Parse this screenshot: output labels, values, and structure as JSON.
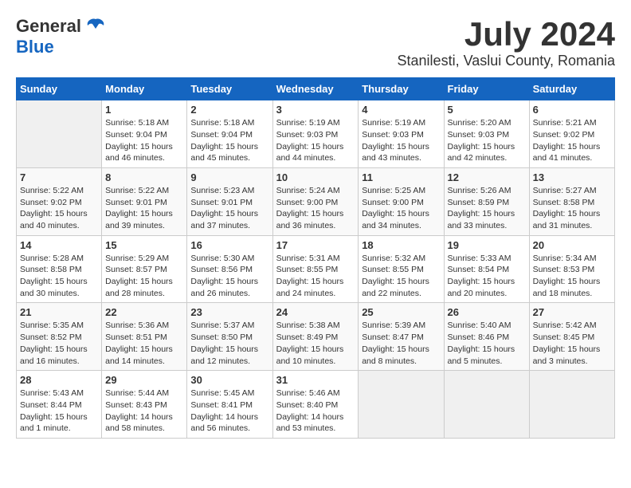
{
  "logo": {
    "general": "General",
    "blue": "Blue"
  },
  "title": {
    "month_year": "July 2024",
    "location": "Stanilesti, Vaslui County, Romania"
  },
  "headers": [
    "Sunday",
    "Monday",
    "Tuesday",
    "Wednesday",
    "Thursday",
    "Friday",
    "Saturday"
  ],
  "weeks": [
    [
      {
        "day": "",
        "info": ""
      },
      {
        "day": "1",
        "info": "Sunrise: 5:18 AM\nSunset: 9:04 PM\nDaylight: 15 hours\nand 46 minutes."
      },
      {
        "day": "2",
        "info": "Sunrise: 5:18 AM\nSunset: 9:04 PM\nDaylight: 15 hours\nand 45 minutes."
      },
      {
        "day": "3",
        "info": "Sunrise: 5:19 AM\nSunset: 9:03 PM\nDaylight: 15 hours\nand 44 minutes."
      },
      {
        "day": "4",
        "info": "Sunrise: 5:19 AM\nSunset: 9:03 PM\nDaylight: 15 hours\nand 43 minutes."
      },
      {
        "day": "5",
        "info": "Sunrise: 5:20 AM\nSunset: 9:03 PM\nDaylight: 15 hours\nand 42 minutes."
      },
      {
        "day": "6",
        "info": "Sunrise: 5:21 AM\nSunset: 9:02 PM\nDaylight: 15 hours\nand 41 minutes."
      }
    ],
    [
      {
        "day": "7",
        "info": "Sunrise: 5:22 AM\nSunset: 9:02 PM\nDaylight: 15 hours\nand 40 minutes."
      },
      {
        "day": "8",
        "info": "Sunrise: 5:22 AM\nSunset: 9:01 PM\nDaylight: 15 hours\nand 39 minutes."
      },
      {
        "day": "9",
        "info": "Sunrise: 5:23 AM\nSunset: 9:01 PM\nDaylight: 15 hours\nand 37 minutes."
      },
      {
        "day": "10",
        "info": "Sunrise: 5:24 AM\nSunset: 9:00 PM\nDaylight: 15 hours\nand 36 minutes."
      },
      {
        "day": "11",
        "info": "Sunrise: 5:25 AM\nSunset: 9:00 PM\nDaylight: 15 hours\nand 34 minutes."
      },
      {
        "day": "12",
        "info": "Sunrise: 5:26 AM\nSunset: 8:59 PM\nDaylight: 15 hours\nand 33 minutes."
      },
      {
        "day": "13",
        "info": "Sunrise: 5:27 AM\nSunset: 8:58 PM\nDaylight: 15 hours\nand 31 minutes."
      }
    ],
    [
      {
        "day": "14",
        "info": "Sunrise: 5:28 AM\nSunset: 8:58 PM\nDaylight: 15 hours\nand 30 minutes."
      },
      {
        "day": "15",
        "info": "Sunrise: 5:29 AM\nSunset: 8:57 PM\nDaylight: 15 hours\nand 28 minutes."
      },
      {
        "day": "16",
        "info": "Sunrise: 5:30 AM\nSunset: 8:56 PM\nDaylight: 15 hours\nand 26 minutes."
      },
      {
        "day": "17",
        "info": "Sunrise: 5:31 AM\nSunset: 8:55 PM\nDaylight: 15 hours\nand 24 minutes."
      },
      {
        "day": "18",
        "info": "Sunrise: 5:32 AM\nSunset: 8:55 PM\nDaylight: 15 hours\nand 22 minutes."
      },
      {
        "day": "19",
        "info": "Sunrise: 5:33 AM\nSunset: 8:54 PM\nDaylight: 15 hours\nand 20 minutes."
      },
      {
        "day": "20",
        "info": "Sunrise: 5:34 AM\nSunset: 8:53 PM\nDaylight: 15 hours\nand 18 minutes."
      }
    ],
    [
      {
        "day": "21",
        "info": "Sunrise: 5:35 AM\nSunset: 8:52 PM\nDaylight: 15 hours\nand 16 minutes."
      },
      {
        "day": "22",
        "info": "Sunrise: 5:36 AM\nSunset: 8:51 PM\nDaylight: 15 hours\nand 14 minutes."
      },
      {
        "day": "23",
        "info": "Sunrise: 5:37 AM\nSunset: 8:50 PM\nDaylight: 15 hours\nand 12 minutes."
      },
      {
        "day": "24",
        "info": "Sunrise: 5:38 AM\nSunset: 8:49 PM\nDaylight: 15 hours\nand 10 minutes."
      },
      {
        "day": "25",
        "info": "Sunrise: 5:39 AM\nSunset: 8:47 PM\nDaylight: 15 hours\nand 8 minutes."
      },
      {
        "day": "26",
        "info": "Sunrise: 5:40 AM\nSunset: 8:46 PM\nDaylight: 15 hours\nand 5 minutes."
      },
      {
        "day": "27",
        "info": "Sunrise: 5:42 AM\nSunset: 8:45 PM\nDaylight: 15 hours\nand 3 minutes."
      }
    ],
    [
      {
        "day": "28",
        "info": "Sunrise: 5:43 AM\nSunset: 8:44 PM\nDaylight: 15 hours\nand 1 minute."
      },
      {
        "day": "29",
        "info": "Sunrise: 5:44 AM\nSunset: 8:43 PM\nDaylight: 14 hours\nand 58 minutes."
      },
      {
        "day": "30",
        "info": "Sunrise: 5:45 AM\nSunset: 8:41 PM\nDaylight: 14 hours\nand 56 minutes."
      },
      {
        "day": "31",
        "info": "Sunrise: 5:46 AM\nSunset: 8:40 PM\nDaylight: 14 hours\nand 53 minutes."
      },
      {
        "day": "",
        "info": ""
      },
      {
        "day": "",
        "info": ""
      },
      {
        "day": "",
        "info": ""
      }
    ]
  ]
}
